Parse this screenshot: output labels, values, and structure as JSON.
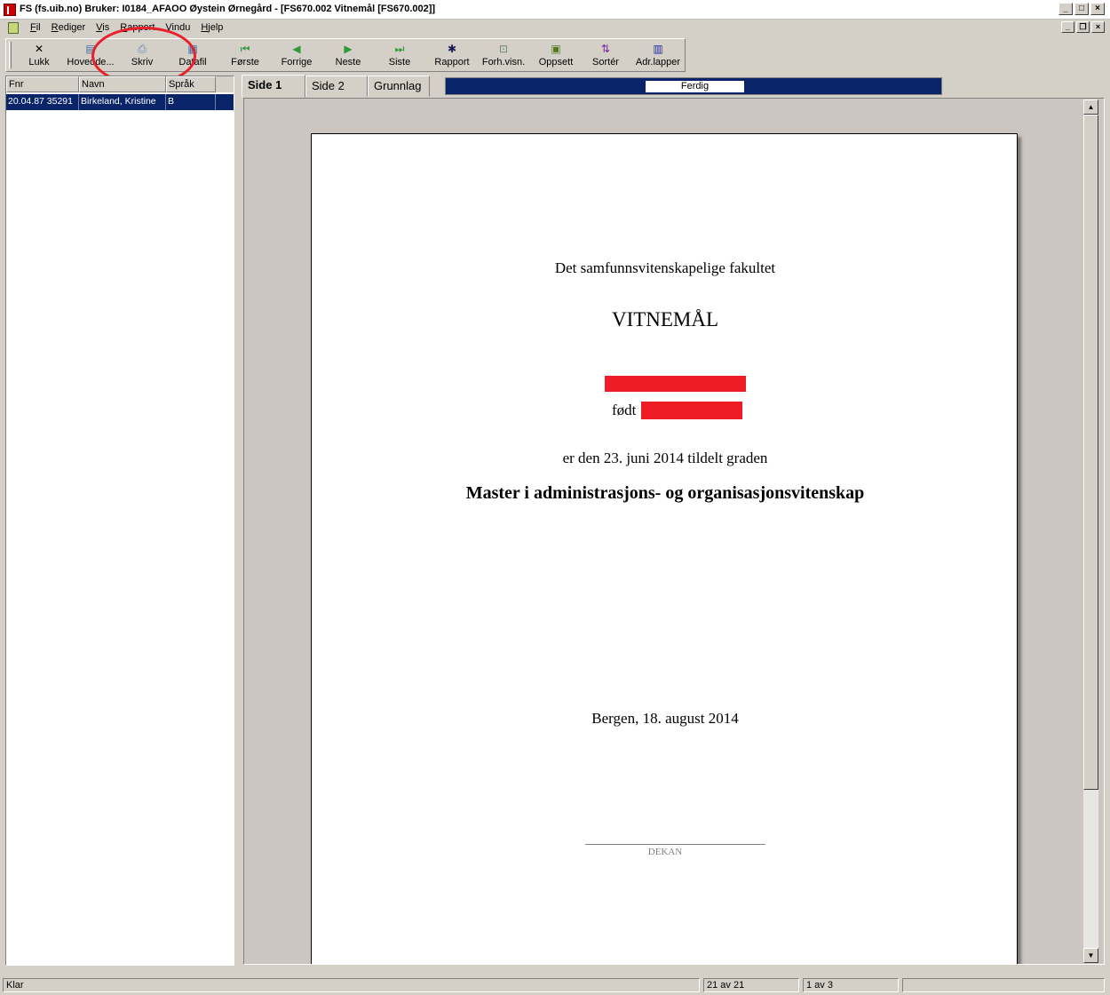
{
  "window": {
    "title": "FS (fs.uib.no) Bruker: I0184_AFAOO Øystein Ørnegård - [FS670.002 Vitnemål  [FS670.002]]"
  },
  "menu": [
    "Fil",
    "Rediger",
    "Vis",
    "Rapport",
    "Vindu",
    "Hjelp"
  ],
  "toolbar": {
    "buttons": [
      {
        "label": "Lukk",
        "icon": "close-icon"
      },
      {
        "label": "Hovedde...",
        "icon": "main-view-icon"
      },
      {
        "label": "Skriv",
        "icon": "printer-icon"
      },
      {
        "label": "Datafil",
        "icon": "datafile-icon"
      },
      {
        "label": "Første",
        "icon": "first-icon"
      },
      {
        "label": "Forrige",
        "icon": "previous-icon"
      },
      {
        "label": "Neste",
        "icon": "next-icon"
      },
      {
        "label": "Siste",
        "icon": "last-icon"
      },
      {
        "label": "Rapport",
        "icon": "report-icon"
      },
      {
        "label": "Forh.visn.",
        "icon": "preview-icon"
      },
      {
        "label": "Oppsett",
        "icon": "setup-icon"
      },
      {
        "label": "Sortér",
        "icon": "sort-icon"
      },
      {
        "label": "Adr.lapper",
        "icon": "address-labels-icon"
      }
    ]
  },
  "grid": {
    "columns": [
      "Fnr",
      "Navn",
      "Språk"
    ],
    "rows": [
      {
        "fnr": "20.04.87 35291",
        "navn": "Birkeland, Kristine",
        "sprak": "B"
      }
    ]
  },
  "tabs": [
    "Side 1",
    "Side 2",
    "Grunnlag"
  ],
  "progress": {
    "label": "Ferdig"
  },
  "document": {
    "faculty": "Det samfunnsvitenskapelige fakultet",
    "heading": "VITNEMÅL",
    "born_label": "født",
    "award_text": "er den 23. juni 2014 tildelt graden",
    "degree": "Master i administrasjons- og organisasjonsvitenskap",
    "place_date": "Bergen, 18. august 2014",
    "signatory": "DEKAN"
  },
  "status": {
    "left": "Klar",
    "count": "21 av 21",
    "page": "1 av 3"
  },
  "colors": {
    "selection": "#0a246a",
    "redaction": "#ee1c25",
    "annotation_circle": "#e8202a"
  }
}
